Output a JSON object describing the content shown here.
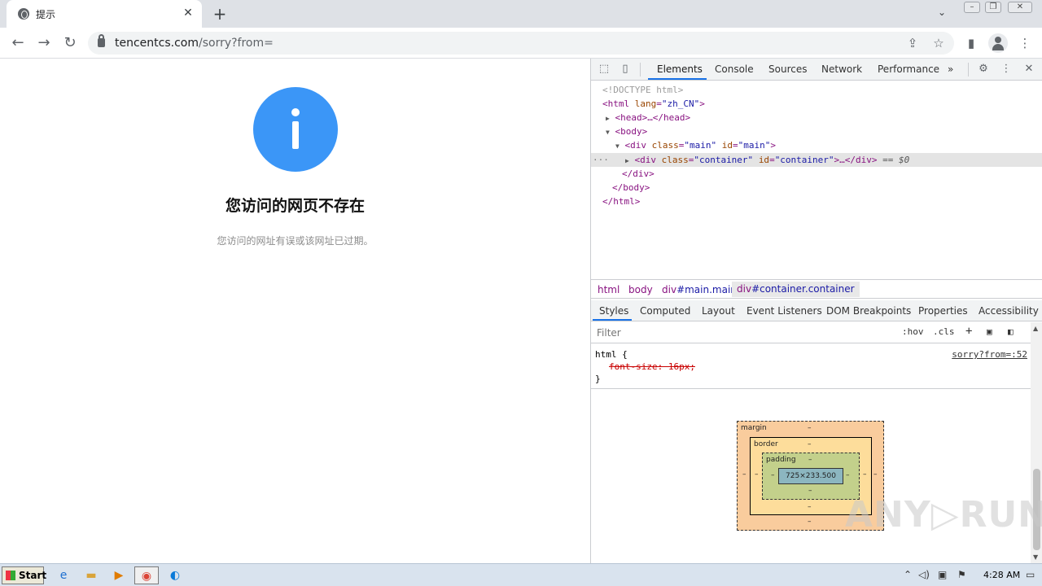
{
  "browser": {
    "tab_title": "提示",
    "new_tab_symbol": "+",
    "url_host": "tencentcs.com",
    "url_path": "/sorry?from="
  },
  "page": {
    "title": "您访问的网页不存在",
    "subtitle": "您访问的网址有误或该网址已过期。"
  },
  "devtools": {
    "tabs": [
      "Elements",
      "Console",
      "Sources",
      "Network",
      "Performance"
    ],
    "more_tabs": "»",
    "dom": {
      "doctype": "<!DOCTYPE html>",
      "html_open": "<html",
      "html_lang_attr": "lang",
      "html_lang_val": "\"zh_CN\"",
      "head": "<head>…</head>",
      "body_open": "<body>",
      "div_main_open": "<div",
      "div_main_class": "\"main\"",
      "div_main_id": "\"main\"",
      "div_container_class": "\"container\"",
      "div_container_id": "\"container\"",
      "div_container_rest": "…</div>",
      "selected_marker": "== $0",
      "div_close": "</div>",
      "body_close": "</body>",
      "html_close": "</html>",
      "ellipsis": "···"
    },
    "breadcrumbs": {
      "html": "html",
      "body": "body",
      "main_tag": "div",
      "main_rest": "#main.main",
      "container_tag": "div",
      "container_rest": "#container.container"
    },
    "sub_tabs": [
      "Styles",
      "Computed",
      "Layout",
      "Event Listeners",
      "DOM Breakpoints",
      "Properties",
      "Accessibility"
    ],
    "filter_placeholder": "Filter",
    "hov": ":hov",
    "cls": ".cls",
    "rule": {
      "selector": "html {",
      "property": "font-size: 16px;",
      "close": "}",
      "source": "sorry?from=:52"
    },
    "box_model": {
      "margin_label": "margin",
      "border_label": "border",
      "padding_label": "padding",
      "content_size": "725×233.500",
      "dash": "–"
    }
  },
  "watermark": "ANY▷RUN",
  "taskbar": {
    "start_label": "Start",
    "clock": "4:28 AM"
  },
  "colors": {
    "info_blue": "#3b96f7",
    "devtools_accent": "#1a73e8"
  }
}
